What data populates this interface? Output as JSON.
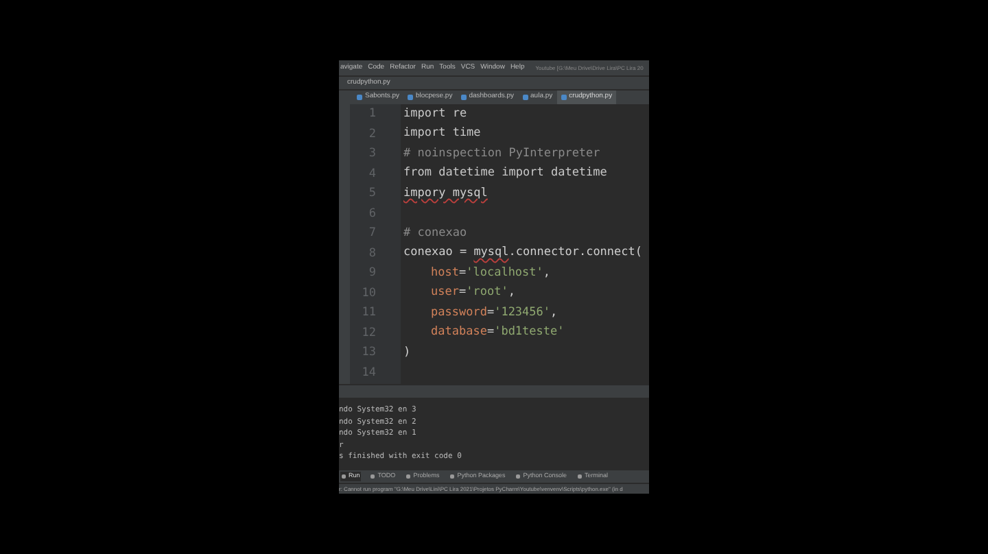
{
  "menu_bar": {
    "items": [
      "avigate",
      "Code",
      "Refactor",
      "Run",
      "Tools",
      "VCS",
      "Window",
      "Help"
    ],
    "title": "Youtube [G:\\Meu Drive\\Drive Lira\\PC Lira 20"
  },
  "breadcrumb": "crudpython.py",
  "tabs": [
    {
      "label": "Sabonts.py",
      "selected": false
    },
    {
      "label": "blocpese.py",
      "selected": false
    },
    {
      "label": "dashboards.py",
      "selected": false
    },
    {
      "label": "aula.py",
      "selected": false
    },
    {
      "label": "crudpython.py",
      "selected": true
    }
  ],
  "editor": {
    "lines": [
      {
        "number": "1",
        "indented": false,
        "tokens": [
          {
            "kind": "keyword",
            "text": "import re"
          }
        ]
      },
      {
        "number": "2",
        "indented": false,
        "tokens": [
          {
            "kind": "keyword",
            "text": "import time"
          }
        ]
      },
      {
        "number": "3",
        "indented": false,
        "tokens": [
          {
            "kind": "comment",
            "text": "# noinspection PyInterpreter"
          }
        ]
      },
      {
        "number": "4",
        "indented": false,
        "tokens": [
          {
            "kind": "keyword",
            "text": "from datetime import datetime"
          }
        ]
      },
      {
        "number": "5",
        "indented": false,
        "tokens": [
          {
            "kind": "plain",
            "text": "impory mysql",
            "error": true
          }
        ]
      },
      {
        "number": "6",
        "indented": false
      },
      {
        "number": "7",
        "indented": false,
        "tokens": [
          {
            "kind": "comment",
            "text": "# conexao"
          }
        ]
      },
      {
        "number": "8",
        "indented": false,
        "tokens": [
          {
            "kind": "plain",
            "text": "conexao = "
          },
          {
            "kind": "plain",
            "text": "mysql",
            "error": true
          },
          {
            "kind": "plain",
            "text": ".connector.connect("
          }
        ]
      },
      {
        "number": "9",
        "indented": true,
        "tokens": [
          {
            "kind": "param",
            "text": "host"
          },
          {
            "kind": "plain",
            "text": "="
          },
          {
            "kind": "string",
            "text": "'localhost'"
          },
          {
            "kind": "plain",
            "text": ","
          }
        ]
      },
      {
        "number": "10",
        "indented": true,
        "tokens": [
          {
            "kind": "param",
            "text": "user"
          },
          {
            "kind": "plain",
            "text": "="
          },
          {
            "kind": "string",
            "text": "'root'"
          },
          {
            "kind": "plain",
            "text": ","
          }
        ]
      },
      {
        "number": "11",
        "indented": true,
        "tokens": [
          {
            "kind": "param",
            "text": "password"
          },
          {
            "kind": "plain",
            "text": "="
          },
          {
            "kind": "string",
            "text": "'123456'"
          },
          {
            "kind": "plain",
            "text": ","
          }
        ]
      },
      {
        "number": "12",
        "indented": true,
        "tokens": [
          {
            "kind": "param",
            "text": "database"
          },
          {
            "kind": "plain",
            "text": "="
          },
          {
            "kind": "string",
            "text": "'bd1teste'"
          }
        ]
      },
      {
        "number": "13",
        "indented": false,
        "tokens": [
          {
            "kind": "plain",
            "text": ")"
          }
        ]
      },
      {
        "number": "14",
        "indented": false
      }
    ]
  },
  "console": {
    "lines": [
      "ndo System32 en 3",
      "ndo System32 en 2",
      "ndo System32 en 1",
      "r",
      "s finished with exit code 0"
    ]
  },
  "tool_tabs": [
    {
      "label": "Run",
      "selected": true
    },
    {
      "label": "TODO",
      "selected": false
    },
    {
      "label": "Problems",
      "selected": false
    },
    {
      "label": "Python Packages",
      "selected": false
    },
    {
      "label": "Python Console",
      "selected": false
    },
    {
      "label": "Terminal",
      "selected": false
    }
  ],
  "status_bar": "r: Cannot run program \"G:\\Meu Drive\\Lini\\PC Lira 2021\\Projetos PyCharm\\Youtube\\venvenv\\Scripts\\python.exe\" (in d"
}
